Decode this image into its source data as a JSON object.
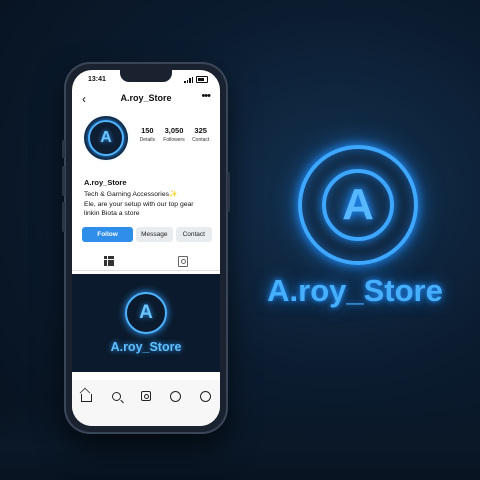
{
  "status": {
    "time": "13:41"
  },
  "profile": {
    "username": "A.roy_Store",
    "avatar_letter": "A",
    "stats": [
      {
        "value": "150",
        "label": "Details"
      },
      {
        "value": "3,050",
        "label": "Followers"
      },
      {
        "value": "325",
        "label": "Contact"
      }
    ],
    "bio_name": "A.roy_Store",
    "bio_lines": [
      "Tech & Garning Accessories✨",
      "Ele, are your setup with our top gear",
      "linkin Biota a store"
    ]
  },
  "actions": {
    "follow": "Follow",
    "message": "Message",
    "contact": "Contact"
  },
  "post": {
    "logo_letter": "A",
    "title": "A.roy_Store"
  },
  "brand": {
    "letter": "A",
    "name": "A.roy_Store",
    "accent": "#3ea7ff"
  }
}
